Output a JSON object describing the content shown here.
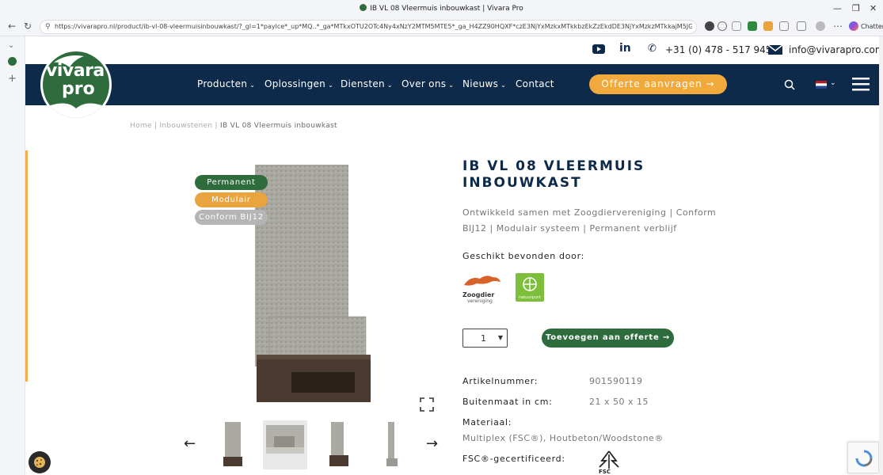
{
  "browser": {
    "tab_title": "IB VL 08 Vleermuis inbouwkast | Vivara Pro",
    "url": "https://vivarapro.nl/product/ib-vl-08-vleermuisinbouwkast/?_gl=1*paylce*_up*MQ..*_ga*MTkxOTU2OTc4Ny4xNzY2MTM5MTE5*_ga_H4ZZ90HQXF*czE3NjYxMzkxMTkkbzEkZzEkdDE3NjYxMzkzMTkkajM5JGwwJGgw",
    "extension_label": "Chatten"
  },
  "topbar": {
    "phone": "+31 (0) 478 - 517 945",
    "email": "info@vivarapro.com"
  },
  "logo": {
    "line1": "vivara",
    "line2": "pro"
  },
  "nav": {
    "items": [
      "Producten",
      "Oplossingen",
      "Diensten",
      "Over ons",
      "Nieuws",
      "Contact"
    ],
    "cta": "Offerte aanvragen →"
  },
  "breadcrumb": {
    "home": "Home",
    "sep": " | ",
    "category": "Inbouwstenen",
    "current": "IB VL 08 Vleermuis inbouwkast"
  },
  "product": {
    "badges": [
      "Permanent",
      "Modulair",
      "Conform BIJ12"
    ],
    "title_line1": "IB VL 08 VLEERMUIS",
    "title_line2": "INBOUWKAST",
    "desc_line1": "Ontwikkeld samen met Zoogdiervereniging | Conform",
    "desc_line2": "BIJ12 | Modulair systeem | Permanent verblijf",
    "suitable_label": "Geschikt bevonden door:",
    "partner1_name": "Zoogdier",
    "partner1_sub": "vereniging",
    "partner2_sub": "natuurpunt",
    "quantity": "1",
    "add_button": "Toevoegen aan offerte →",
    "specs": {
      "article_label": "Artikelnummer:",
      "article_value": "901590119",
      "size_label": "Buitenmaat in cm:",
      "size_value": "21 x 50 x 15",
      "material_label": "Materiaal:",
      "material_value": "Multiplex (FSC®), Houtbeton/Woodstone®",
      "fsc_label": "FSC®-gecertificeerd:",
      "fsc_mark": "FSC"
    }
  },
  "colors": {
    "navy": "#0e2a4a",
    "green": "#2e6b3d",
    "orange": "#f2a93b",
    "grey_badge": "#b5b5b5"
  }
}
